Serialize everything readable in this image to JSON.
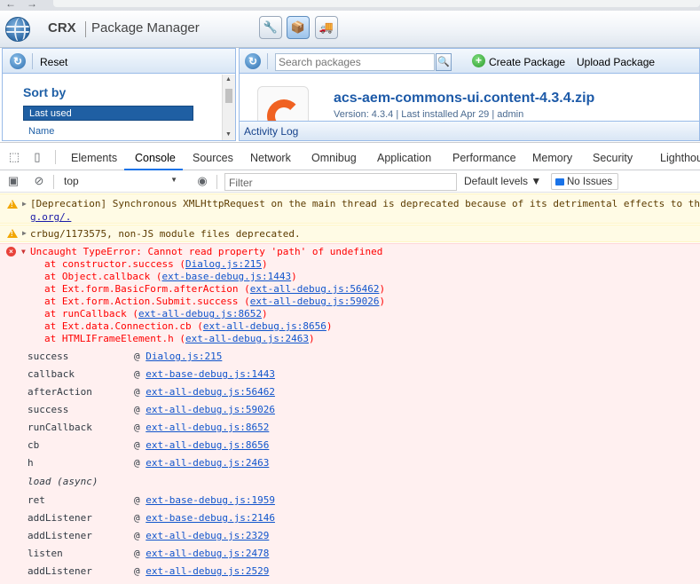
{
  "crx": {
    "brand": "CRX",
    "title": "Package Manager"
  },
  "left_panel": {
    "reset_label": "Reset",
    "sort_title": "Sort by",
    "sort_items": [
      "Last used",
      "Name"
    ]
  },
  "right_panel": {
    "search_placeholder": "Search packages",
    "create_label": "Create Package",
    "upload_label": "Upload Package",
    "package_name": "acs-aem-commons-ui.content-4.3.4.zip",
    "package_meta": "Version: 4.3.4 | Last installed Apr 29 | admin",
    "activity_log": "Activity Log"
  },
  "devtools": {
    "tabs": [
      "Elements",
      "Console",
      "Sources",
      "Network",
      "Omnibug",
      "Application",
      "Performance",
      "Memory",
      "Security",
      "Lighthouse"
    ],
    "active_tab": "Console",
    "context": "top",
    "filter_placeholder": "Filter",
    "levels": "Default levels ▼",
    "issues": "No Issues"
  },
  "console": {
    "warn1_text": "[Deprecation] Synchronous XMLHttpRequest on the main thread is deprecated because of its detrimental effects to the",
    "warn1_link": "g.org/.",
    "warn2_text": "crbug/1173575, non-JS module files deprecated.",
    "error_title": "Uncaught TypeError: Cannot read property 'path' of undefined",
    "error_frames": [
      {
        "fn": "at constructor.success",
        "loc": "Dialog.js:215"
      },
      {
        "fn": "at Object.callback",
        "loc": "ext-base-debug.js:1443"
      },
      {
        "fn": "at Ext.form.BasicForm.afterAction",
        "loc": "ext-all-debug.js:56462"
      },
      {
        "fn": "at Ext.form.Action.Submit.success",
        "loc": "ext-all-debug.js:59026"
      },
      {
        "fn": "at runCallback",
        "loc": "ext-all-debug.js:8652"
      },
      {
        "fn": "at Ext.data.Connection.cb",
        "loc": "ext-all-debug.js:8656"
      },
      {
        "fn": "at HTMLIFrameElement.h",
        "loc": "ext-all-debug.js:2463"
      }
    ],
    "stack": [
      {
        "fn": "success",
        "loc": "Dialog.js:215"
      },
      {
        "fn": "callback",
        "loc": "ext-base-debug.js:1443"
      },
      {
        "fn": "afterAction",
        "loc": "ext-all-debug.js:56462"
      },
      {
        "fn": "success",
        "loc": "ext-all-debug.js:59026"
      },
      {
        "fn": "runCallback",
        "loc": "ext-all-debug.js:8652"
      },
      {
        "fn": "cb",
        "loc": "ext-all-debug.js:8656"
      },
      {
        "fn": "h",
        "loc": "ext-all-debug.js:2463"
      }
    ],
    "async_label": "load (async)",
    "stack2": [
      {
        "fn": "ret",
        "loc": "ext-base-debug.js:1959"
      },
      {
        "fn": "addListener",
        "loc": "ext-base-debug.js:2146"
      },
      {
        "fn": "addListener",
        "loc": "ext-all-debug.js:2329"
      },
      {
        "fn": "listen",
        "loc": "ext-all-debug.js:2478"
      },
      {
        "fn": "addListener",
        "loc": "ext-all-debug.js:2529"
      }
    ]
  }
}
